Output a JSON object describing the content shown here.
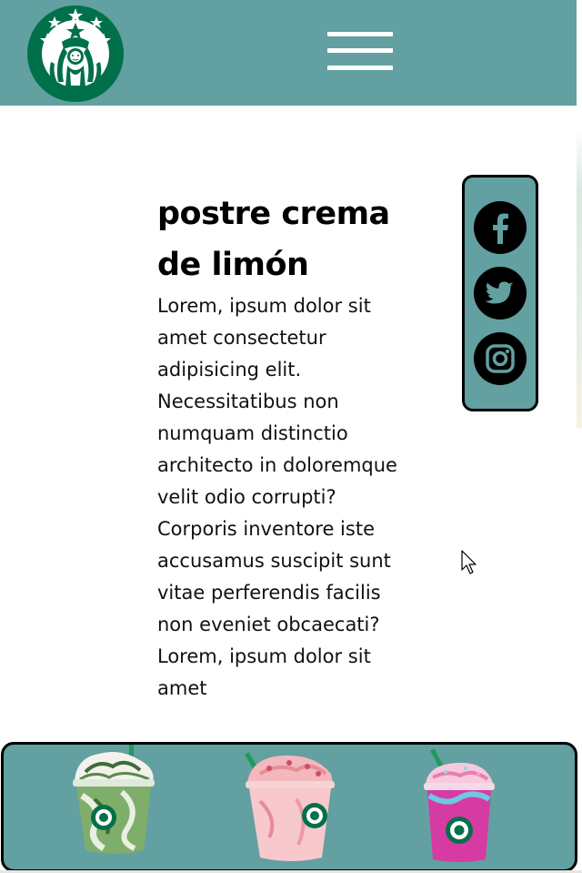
{
  "header": {
    "logo_icon": "starbucks-siren-logo",
    "menu_icon": "hamburger-menu-icon",
    "background": "#62a0a1"
  },
  "article": {
    "title": "postre crema de limón",
    "body": "Lorem, ipsum dolor sit amet consectetur adipisicing elit. Necessitatibus non numquam distinctio architecto in doloremque velit odio corrupti? Corporis inventore iste accusamus suscipit sunt vitae perferendis facilis non eveniet obcaecati?Lorem, ipsum dolor sit amet"
  },
  "social": {
    "items": [
      {
        "icon": "facebook-icon"
      },
      {
        "icon": "twitter-icon"
      },
      {
        "icon": "instagram-icon"
      }
    ]
  },
  "products": {
    "items": [
      {
        "icon": "matcha-frappuccino-image"
      },
      {
        "icon": "strawberry-frappuccino-image"
      },
      {
        "icon": "unicorn-frappuccino-image"
      }
    ]
  },
  "colors": {
    "brand_teal": "#62a0a1",
    "starbucks_green": "#00704a",
    "border": "#000000"
  }
}
